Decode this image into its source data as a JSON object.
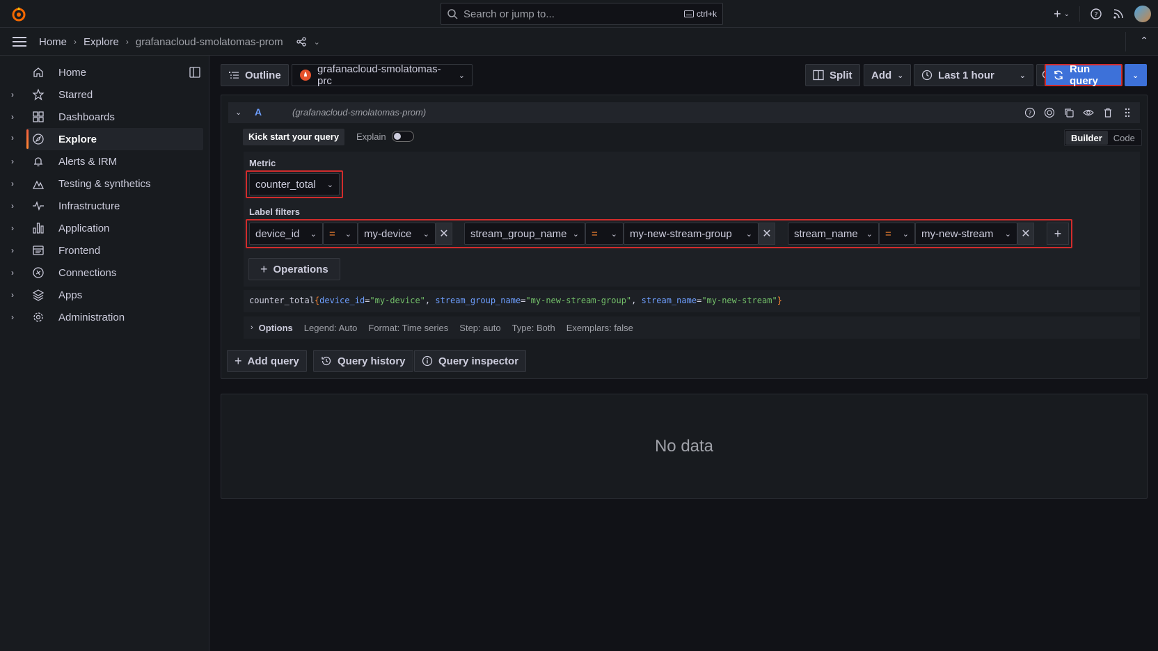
{
  "topbar": {
    "search_placeholder": "Search or jump to...",
    "search_shortcut": "ctrl+k"
  },
  "breadcrumb": {
    "items": [
      "Home",
      "Explore",
      "grafanacloud-smolatomas-prom"
    ]
  },
  "sidebar": {
    "items": [
      {
        "label": "Home",
        "icon": "home-icon",
        "expandable": false
      },
      {
        "label": "Starred",
        "icon": "star-icon",
        "expandable": true
      },
      {
        "label": "Dashboards",
        "icon": "apps-icon",
        "expandable": true
      },
      {
        "label": "Explore",
        "icon": "compass-icon",
        "expandable": true,
        "active": true
      },
      {
        "label": "Alerts & IRM",
        "icon": "bell-icon",
        "expandable": true
      },
      {
        "label": "Testing & synthetics",
        "icon": "heart-rate-icon",
        "expandable": true
      },
      {
        "label": "Infrastructure",
        "icon": "heartbeat-icon",
        "expandable": true
      },
      {
        "label": "Application",
        "icon": "chart-icon",
        "expandable": true
      },
      {
        "label": "Frontend",
        "icon": "frontend-icon",
        "expandable": true
      },
      {
        "label": "Connections",
        "icon": "link-icon",
        "expandable": true
      },
      {
        "label": "Apps",
        "icon": "layers-icon",
        "expandable": true
      },
      {
        "label": "Administration",
        "icon": "cog-icon",
        "expandable": true
      }
    ]
  },
  "toolbar": {
    "outline": "Outline",
    "datasource": "grafanacloud-smolatomas-prc",
    "split": "Split",
    "add": "Add",
    "time_range": "Last 1 hour",
    "run_query": "Run query"
  },
  "query": {
    "ref_id": "A",
    "datasource_hint": "(grafanacloud-smolatomas-prom)",
    "kick_start": "Kick start your query",
    "explain": "Explain",
    "modes": [
      "Builder",
      "Code"
    ],
    "active_mode": "Builder",
    "metric_label": "Metric",
    "metric": "counter_total",
    "label_filters_label": "Label filters",
    "filters": [
      {
        "label": "device_id",
        "op": "=",
        "value": "my-device"
      },
      {
        "label": "stream_group_name",
        "op": "=",
        "value": "my-new-stream-group"
      },
      {
        "label": "stream_name",
        "op": "=",
        "value": "my-new-stream"
      }
    ],
    "operations": "Operations",
    "promql": {
      "metric": "counter_total",
      "open": "{",
      "close": "}",
      "parts": [
        {
          "label": "device_id",
          "eq": "=",
          "value": "\"my-device\"",
          "sep": ", "
        },
        {
          "label": "stream_group_name",
          "eq": "=",
          "value": "\"my-new-stream-group\"",
          "sep": ", "
        },
        {
          "label": "stream_name",
          "eq": "=",
          "value": "\"my-new-stream\"",
          "sep": ""
        }
      ]
    },
    "options": {
      "title": "Options",
      "legend": "Legend: Auto",
      "format": "Format: Time series",
      "step": "Step: auto",
      "type": "Type: Both",
      "exemplars": "Exemplars: false"
    }
  },
  "actions": {
    "add_query": "Add query",
    "query_history": "Query history",
    "query_inspector": "Query inspector"
  },
  "results": {
    "empty": "No data"
  },
  "colors": {
    "accent": "#3d71d9",
    "highlight": "#d22c2c",
    "operator": "#ff8833",
    "label": "#6e9fff",
    "string": "#73bf69"
  }
}
